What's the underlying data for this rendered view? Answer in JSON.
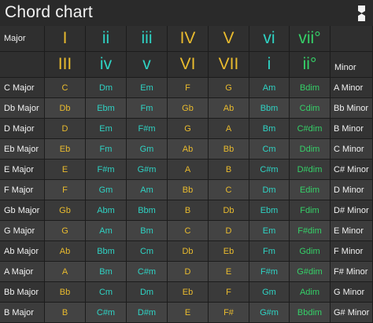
{
  "title": "Chord chart",
  "major_header_label": "Major",
  "minor_header_label": "Minor",
  "major_numerals": [
    "I",
    "ii",
    "iii",
    "IV",
    "V",
    "vi",
    "vii°"
  ],
  "minor_numerals": [
    "III",
    "iv",
    "v",
    "VI",
    "VII",
    "i",
    "ii°"
  ],
  "numeral_colors": {
    "major": [
      "yellow",
      "teal",
      "teal",
      "yellow",
      "yellow",
      "teal",
      "green"
    ],
    "minor": [
      "yellow",
      "teal",
      "teal",
      "yellow",
      "yellow",
      "teal",
      "green"
    ]
  },
  "colors": {
    "major_chord": "#e9bb2e",
    "minor_chord": "#2fd3c4",
    "diminished_chord": "#35d068"
  },
  "rows": [
    {
      "major": "C Major",
      "chords": [
        "C",
        "Dm",
        "Em",
        "F",
        "G",
        "Am",
        "Bdim"
      ],
      "minor": "A Minor"
    },
    {
      "major": "Db Major",
      "chords": [
        "Db",
        "Ebm",
        "Fm",
        "Gb",
        "Ab",
        "Bbm",
        "Cdim"
      ],
      "minor": "Bb Minor"
    },
    {
      "major": "D Major",
      "chords": [
        "D",
        "Em",
        "F#m",
        "G",
        "A",
        "Bm",
        "C#dim"
      ],
      "minor": "B Minor"
    },
    {
      "major": "Eb Major",
      "chords": [
        "Eb",
        "Fm",
        "Gm",
        "Ab",
        "Bb",
        "Cm",
        "Ddim"
      ],
      "minor": "C Minor"
    },
    {
      "major": "E Major",
      "chords": [
        "E",
        "F#m",
        "G#m",
        "A",
        "B",
        "C#m",
        "D#dim"
      ],
      "minor": "C# Minor"
    },
    {
      "major": "F Major",
      "chords": [
        "F",
        "Gm",
        "Am",
        "Bb",
        "C",
        "Dm",
        "Edim"
      ],
      "minor": "D Minor"
    },
    {
      "major": "Gb Major",
      "chords": [
        "Gb",
        "Abm",
        "Bbm",
        "B",
        "Db",
        "Ebm",
        "Fdim"
      ],
      "minor": "D# Minor"
    },
    {
      "major": "G Major",
      "chords": [
        "G",
        "Am",
        "Bm",
        "C",
        "D",
        "Em",
        "F#dim"
      ],
      "minor": "E Minor"
    },
    {
      "major": "Ab Major",
      "chords": [
        "Ab",
        "Bbm",
        "Cm",
        "Db",
        "Eb",
        "Fm",
        "Gdim"
      ],
      "minor": "F Minor"
    },
    {
      "major": "A Major",
      "chords": [
        "A",
        "Bm",
        "C#m",
        "D",
        "E",
        "F#m",
        "G#dim"
      ],
      "minor": "F# Minor"
    },
    {
      "major": "Bb Major",
      "chords": [
        "Bb",
        "Cm",
        "Dm",
        "Eb",
        "F",
        "Gm",
        "Adim"
      ],
      "minor": "G Minor"
    },
    {
      "major": "B Major",
      "chords": [
        "B",
        "C#m",
        "D#m",
        "E",
        "F#",
        "G#m",
        "Bbdim"
      ],
      "minor": "G# Minor"
    }
  ],
  "chord_quality": [
    "major",
    "minor",
    "minor",
    "major",
    "major",
    "minor",
    "dim"
  ]
}
